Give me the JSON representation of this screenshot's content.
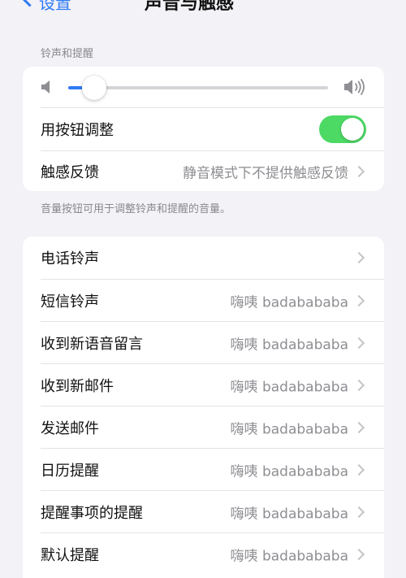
{
  "nav": {
    "back_label": "设置",
    "title": "声音与触感"
  },
  "ringer": {
    "section_header": "铃声和提醒",
    "volume_level": 0.1,
    "change_with_buttons_label": "用按钮调整",
    "change_with_buttons_on": true,
    "haptics_label": "触感反馈",
    "haptics_value": "静音模式下不提供触感反馈",
    "footer_note": "音量按钮可用于调整铃声和提醒的音量。"
  },
  "sounds": [
    {
      "label": "电话铃声",
      "value": ""
    },
    {
      "label": "短信铃声",
      "value": "嗨咦 badababab‍a"
    },
    {
      "label": "收到新语音留言",
      "value": "嗨咦 badabababa"
    },
    {
      "label": "收到新邮件",
      "value": "嗨咦 badabababa"
    },
    {
      "label": "发送邮件",
      "value": "嗨咦 badabababa"
    },
    {
      "label": "日历提醒",
      "value": "嗨咦 badabababa"
    },
    {
      "label": "提醒事项的提醒",
      "value": "嗨咦 badabababa"
    },
    {
      "label": "默认提醒",
      "value": "嗨咦 badabababa"
    }
  ],
  "colors": {
    "accent": "#2f7bf5",
    "toggle_on": "#4cd964",
    "background": "#f2f2f7",
    "secondary_text": "#8e8e93"
  }
}
